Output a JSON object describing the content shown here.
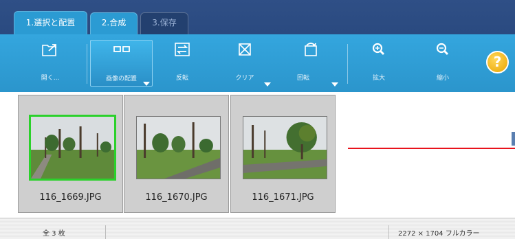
{
  "tabs": [
    {
      "label": "1.選択と配置",
      "active": true
    },
    {
      "label": "2.合成",
      "active": false
    },
    {
      "label": "3.保存",
      "active": false
    }
  ],
  "toolbar": {
    "open": "開く...",
    "layout": "画像の配置",
    "flip": "反転",
    "clear": "クリア",
    "rotate": "回転",
    "zoom_in": "拡大",
    "zoom_out": "縮小",
    "help": "?"
  },
  "thumbnails": [
    {
      "filename": "116_1669.JPG",
      "selected": true
    },
    {
      "filename": "116_1670.JPG",
      "selected": false
    },
    {
      "filename": "116_1671.JPG",
      "selected": false
    }
  ],
  "status": {
    "count": "全 3 枚",
    "info": "2272 × 1704 フルカラー"
  },
  "colors": {
    "tabbar": "#2f4f86",
    "toolbar": "#34a6de",
    "selection": "#2bd12b",
    "guide_line": "#e8131c",
    "help_button": "#f0b400"
  }
}
